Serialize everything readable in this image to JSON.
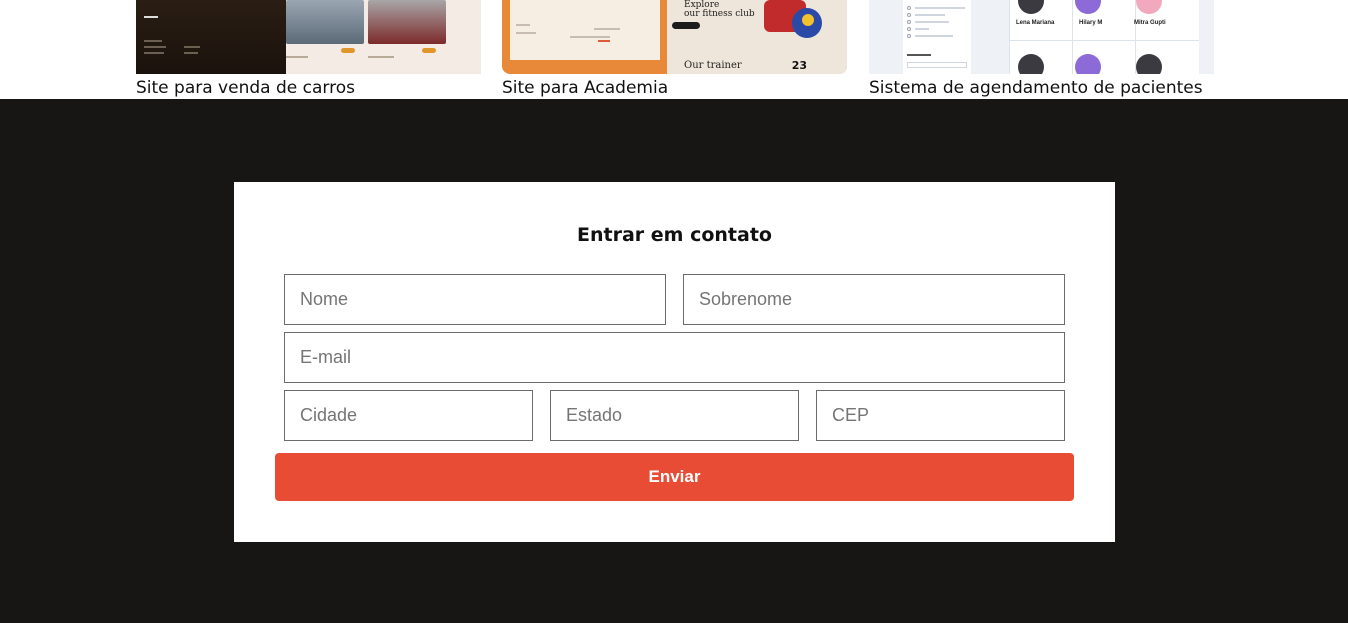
{
  "portfolio": {
    "projects": [
      {
        "caption": "Site para venda de carros"
      },
      {
        "caption": "Site para Academia",
        "thumb_texts": [
          "Explore",
          "our fitness club",
          "Our trainer",
          "23"
        ]
      },
      {
        "caption": "Sistema de agendamento de pacientes",
        "thumb_texts": [
          "Lena Mariana",
          "Hilary M",
          "Mitra Gupti"
        ]
      }
    ]
  },
  "contact": {
    "title": "Entrar em contato",
    "fields": {
      "nome": {
        "placeholder": "Nome",
        "value": ""
      },
      "sobrenome": {
        "placeholder": "Sobrenome",
        "value": ""
      },
      "email": {
        "placeholder": "E-mail",
        "value": ""
      },
      "cidade": {
        "placeholder": "Cidade",
        "value": ""
      },
      "estado": {
        "placeholder": "Estado",
        "value": ""
      },
      "cep": {
        "placeholder": "CEP",
        "value": ""
      }
    },
    "submit_label": "Enviar"
  },
  "colors": {
    "dark_background": "#171615",
    "accent": "#e84c35",
    "card_background": "#ffffff"
  }
}
